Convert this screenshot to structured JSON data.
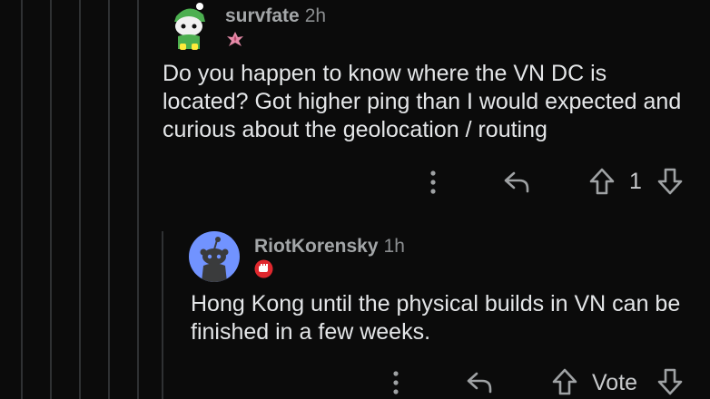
{
  "comment": {
    "username": "survfate",
    "time": "2h",
    "avatar_icon": "green-snoo-avatar-icon",
    "flair_icon": "pink-flower-flair-icon",
    "body": "Do you happen to know where the VN DC is located? Got higher ping than I would expected and curious about the geolocation / routing",
    "vote_count": "1",
    "actions": {
      "more": "more-options-icon",
      "reply": "reply-icon",
      "upvote": "upvote-icon",
      "downvote": "downvote-icon"
    }
  },
  "reply": {
    "username": "RiotKorensky",
    "time": "1h",
    "avatar_icon": "default-snoo-avatar-icon",
    "flair_icon": "red-fist-flair-icon",
    "body": "Hong Kong until the physical builds in VN can be finished in a few weeks.",
    "vote_label": "Vote",
    "actions": {
      "more": "more-options-icon",
      "reply": "reply-icon",
      "upvote": "upvote-icon",
      "downvote": "downvote-icon"
    }
  },
  "colors": {
    "background": "#0b0b0b",
    "thread_line": "#2f3133",
    "text": "#e4e6e8",
    "username": "#a3a6a8",
    "avatar_default_bg": "#7193ff",
    "flair_red": "#e0282e"
  }
}
